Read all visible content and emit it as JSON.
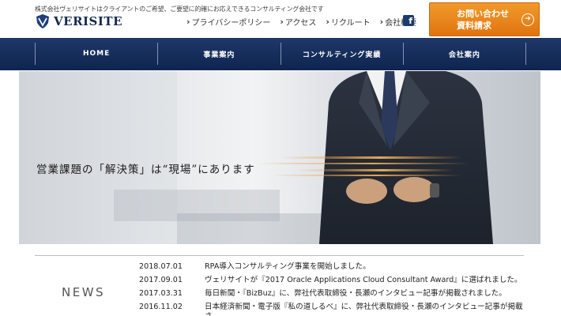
{
  "header": {
    "tagline": "株式会社ヴェリサイトはクライアントのご希望、ご要望に的確にお応えできるコンサルティング会社です",
    "logo_text": "VERISITE",
    "top_links": [
      {
        "label": "プライバシーポリシー"
      },
      {
        "label": "アクセス"
      },
      {
        "label": "リクルート"
      },
      {
        "label": "会社概要"
      }
    ],
    "cta_line1": "お問い合わせ",
    "cta_line2": "資料請求"
  },
  "main_nav": [
    {
      "label": "HOME"
    },
    {
      "label": "事業案内"
    },
    {
      "label": "コンサルティング実績"
    },
    {
      "label": "会社案内"
    }
  ],
  "hero": {
    "caption": "営業課題の「解決策」は“現場”にあります"
  },
  "news": {
    "heading": "NEWS",
    "items": [
      {
        "date": "2018.07.01",
        "text": "RPA導入コンサルティング事業を開始しました。"
      },
      {
        "date": "2017.09.01",
        "text": "ヴェリサイトが『2017 Oracle Applications Cloud Consultant Award』に選ばれました。"
      },
      {
        "date": "2017.03.31",
        "text": "毎日新聞・『BizBuz』に、弊社代表取締役・長瀬のインタビュー記事が掲載されました。"
      },
      {
        "date": "2016.11.02",
        "text": "日本経済新聞・電子版『私の道しるべ』に、弊社代表取締役・長瀬のインタビュー記事が掲載さ"
      }
    ]
  },
  "colors": {
    "navy": "#0f2450",
    "orange": "#e8821c"
  }
}
